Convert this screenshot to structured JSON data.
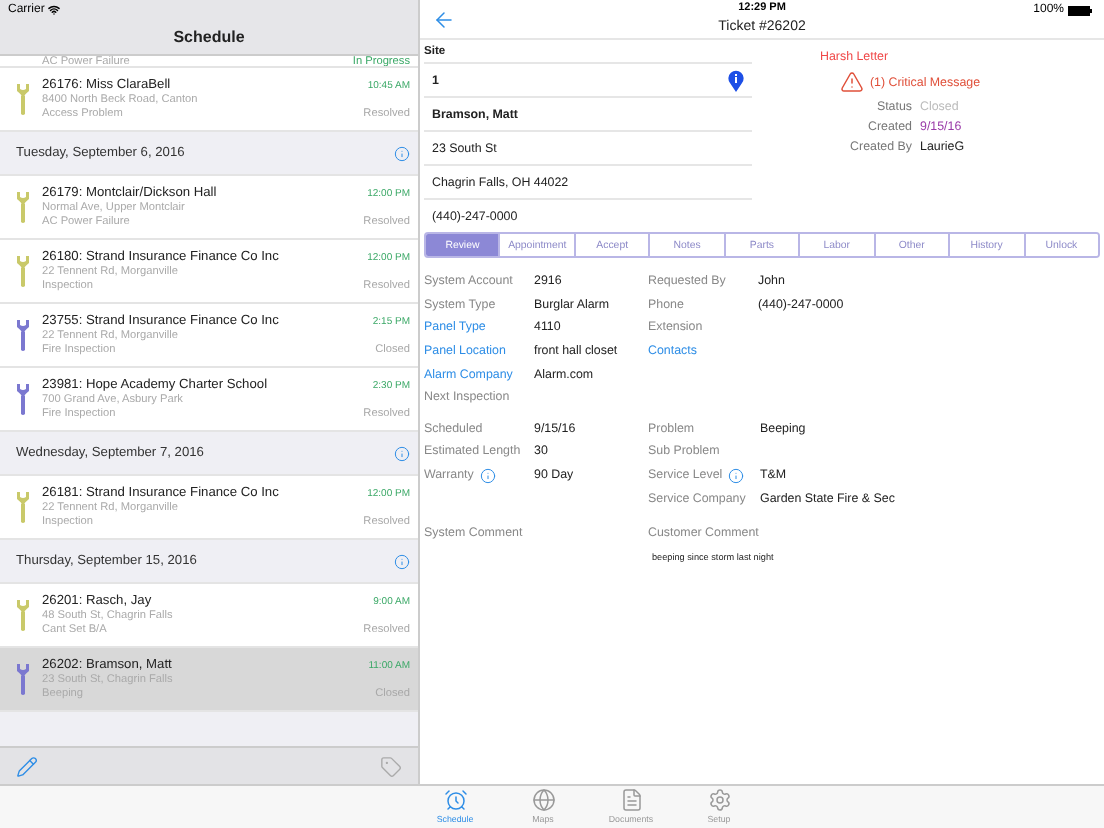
{
  "status_bar": {
    "carrier": "Carrier",
    "time": "12:29 PM",
    "battery": "100%"
  },
  "schedule": {
    "title": "Schedule",
    "rows": [
      {
        "kind": "partial",
        "problem": "AC Power Failure",
        "status": "In Progress",
        "active": true
      },
      {
        "kind": "ticket",
        "title": "26176: Miss ClaraBell",
        "address": "8400 North Beck Road, Canton",
        "problem": "Access Problem",
        "time": "10:45 AM",
        "status": "Resolved",
        "active": false,
        "color": "#c9c96a",
        "selected": false
      },
      {
        "kind": "section",
        "title": "Tuesday, September 6, 2016"
      },
      {
        "kind": "ticket",
        "title": "26179: Montclair/Dickson Hall",
        "address": "Normal Ave, Upper Montclair",
        "problem": "AC Power Failure",
        "time": "12:00 PM",
        "status": "Resolved",
        "active": false,
        "color": "#c9c96a",
        "selected": false
      },
      {
        "kind": "ticket",
        "title": "26180: Strand Insurance Finance Co Inc",
        "address": "22 Tennent Rd, Morganville",
        "problem": "Inspection",
        "time": "12:00 PM",
        "status": "Resolved",
        "active": false,
        "color": "#c9c96a",
        "selected": false
      },
      {
        "kind": "ticket",
        "title": "23755: Strand Insurance Finance Co Inc",
        "address": "22 Tennent Rd, Morganville",
        "problem": "Fire  Inspection",
        "time": "2:15 PM",
        "status": "Closed",
        "active": false,
        "color": "#7b78d0",
        "selected": false
      },
      {
        "kind": "ticket",
        "title": "23981: Hope Academy Charter School",
        "address": "700 Grand Ave, Asbury Park",
        "problem": "Fire  Inspection",
        "time": "2:30 PM",
        "status": "Resolved",
        "active": false,
        "color": "#7b78d0",
        "selected": false
      },
      {
        "kind": "section",
        "title": "Wednesday, September 7, 2016"
      },
      {
        "kind": "ticket",
        "title": "26181: Strand Insurance Finance Co Inc",
        "address": "22 Tennent Rd, Morganville",
        "problem": "Inspection",
        "time": "12:00 PM",
        "status": "Resolved",
        "active": false,
        "color": "#c9c96a",
        "selected": false
      },
      {
        "kind": "section",
        "title": "Thursday, September 15, 2016"
      },
      {
        "kind": "ticket",
        "title": "26201: Rasch, Jay",
        "address": "48 South St, Chagrin Falls",
        "problem": "Cant Set B/A",
        "time": "9:00 AM",
        "status": "Resolved",
        "active": false,
        "color": "#c9c96a",
        "selected": false
      },
      {
        "kind": "ticket",
        "title": "26202: Bramson, Matt",
        "address": "23 South St, Chagrin Falls",
        "problem": "Beeping",
        "time": "11:00 AM",
        "status": "Closed",
        "active": false,
        "color": "#7b78d0",
        "selected": true
      }
    ]
  },
  "ticket": {
    "title": "Ticket #26202",
    "site_label": "Site",
    "site_fields": [
      {
        "value": "1",
        "bold": true,
        "pin": true
      },
      {
        "value": "Bramson, Matt",
        "bold": true,
        "pin": false
      },
      {
        "value": "23 South St",
        "bold": false,
        "pin": false
      },
      {
        "value": "Chagrin Falls, OH 44022",
        "bold": false,
        "pin": false
      },
      {
        "value": "(440)-247-0000",
        "bold": false,
        "pin": false
      }
    ],
    "harsh_letter": "Harsh Letter",
    "critical_message": "(1) Critical Message",
    "info": [
      {
        "label": "Status",
        "value": "Closed",
        "kind": "status"
      },
      {
        "label": "Created",
        "value": "9/15/16",
        "kind": "date"
      },
      {
        "label": "Created By",
        "value": "LaurieG",
        "kind": "text"
      }
    ],
    "tabs": [
      {
        "label": "Review",
        "selected": true
      },
      {
        "label": "Appointment",
        "selected": false
      },
      {
        "label": "Accept",
        "selected": false
      },
      {
        "label": "Notes",
        "selected": false
      },
      {
        "label": "Parts",
        "selected": false
      },
      {
        "label": "Labor",
        "selected": false
      },
      {
        "label": "Other",
        "selected": false
      },
      {
        "label": "History",
        "selected": false
      },
      {
        "label": "Unlock",
        "selected": false
      }
    ],
    "details_left": [
      {
        "label": "System Account",
        "value": "2916",
        "link": false,
        "info": false
      },
      {
        "label": "System Type",
        "value": "Burglar Alarm",
        "link": false,
        "info": false
      },
      {
        "label": "Panel Type",
        "value": "4110",
        "link": true,
        "info": false
      },
      {
        "label": "Panel Location",
        "value": "front hall closet",
        "link": true,
        "info": false
      },
      {
        "label": "Alarm Company",
        "value": "Alarm.com",
        "link": true,
        "info": false
      },
      {
        "label": "Next Inspection",
        "link": false,
        "info": false
      }
    ],
    "details_right": [
      {
        "label": "Requested By",
        "value": "John",
        "link": false,
        "info": false
      },
      {
        "label": "Phone",
        "value": "(440)-247-0000",
        "link": false,
        "info": false
      },
      {
        "label": "Extension",
        "link": false,
        "info": false
      },
      {
        "label": "Contacts",
        "link": true,
        "info": false
      }
    ],
    "schedule_left": [
      {
        "label": "Scheduled",
        "value": "9/15/16",
        "link": false,
        "info": false
      },
      {
        "label": "Estimated Length",
        "value": "30",
        "link": false,
        "info": false
      },
      {
        "label": "Warranty",
        "value": "90 Day",
        "link": false,
        "info": true
      }
    ],
    "schedule_right": [
      {
        "label": "Problem",
        "value": "Beeping",
        "link": false,
        "info": false
      },
      {
        "label": "Sub Problem",
        "link": false,
        "info": false
      },
      {
        "label": "Service Level",
        "value": "T&M",
        "link": false,
        "info": true
      },
      {
        "label": "Service Company",
        "value": "Garden State Fire & Sec",
        "link": false,
        "info": false
      }
    ],
    "system_comment_label": "System Comment",
    "customer_comment_label": "Customer Comment",
    "customer_comment": "beeping since storm last night"
  },
  "tab_bar": [
    {
      "kind": "schedule",
      "label": "Schedule",
      "selected": true
    },
    {
      "kind": "maps",
      "label": "Maps",
      "selected": false
    },
    {
      "kind": "documents",
      "label": "Documents",
      "selected": false
    },
    {
      "kind": "setup",
      "label": "Setup",
      "selected": false
    }
  ]
}
